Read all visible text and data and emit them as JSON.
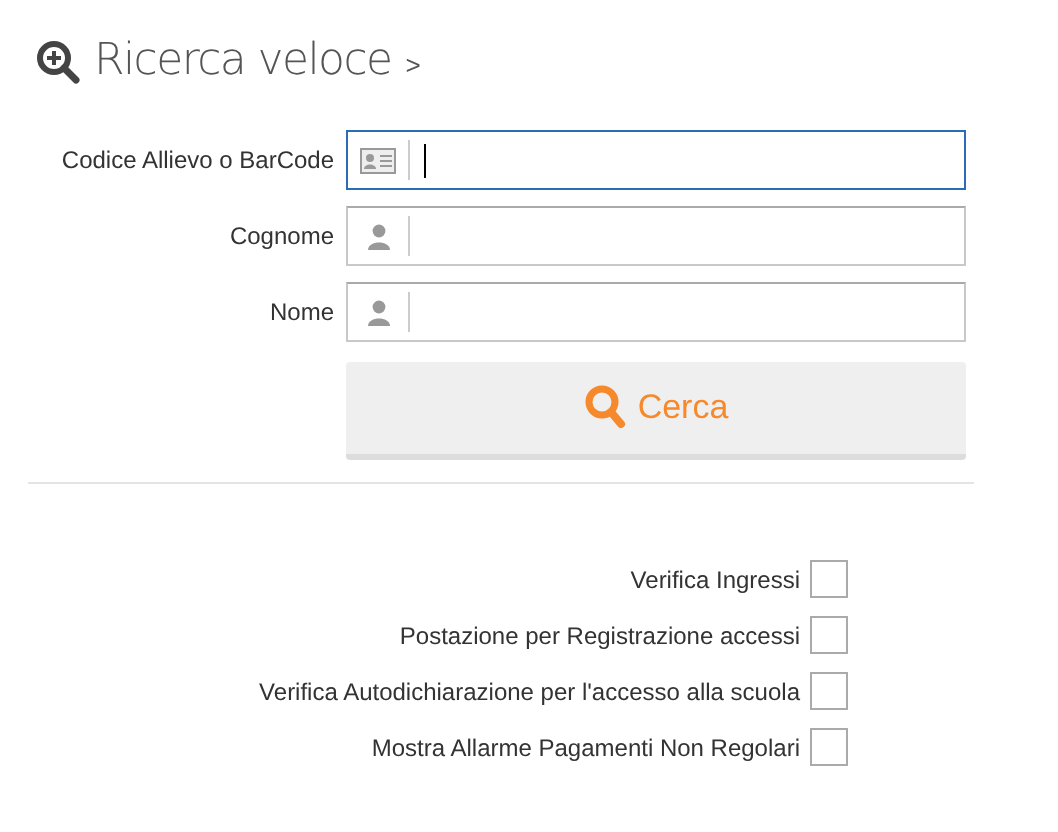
{
  "header": {
    "title": "Ricerca veloce",
    "chevron": ">"
  },
  "fields": [
    {
      "label": "Codice Allievo o BarCode",
      "kind": "card",
      "focused": true
    },
    {
      "label": "Cognome",
      "kind": "person",
      "focused": false
    },
    {
      "label": "Nome",
      "kind": "person",
      "focused": false
    }
  ],
  "search_button": {
    "label": "Cerca"
  },
  "options": [
    {
      "label": "Verifica Ingressi",
      "checked": false
    },
    {
      "label": "Postazione per Registrazione accessi",
      "checked": false
    },
    {
      "label": "Verifica Autodichiarazione per l'accesso alla scuola",
      "checked": false
    },
    {
      "label": "Mostra Allarme Pagamenti Non Regolari",
      "checked": false
    }
  ]
}
